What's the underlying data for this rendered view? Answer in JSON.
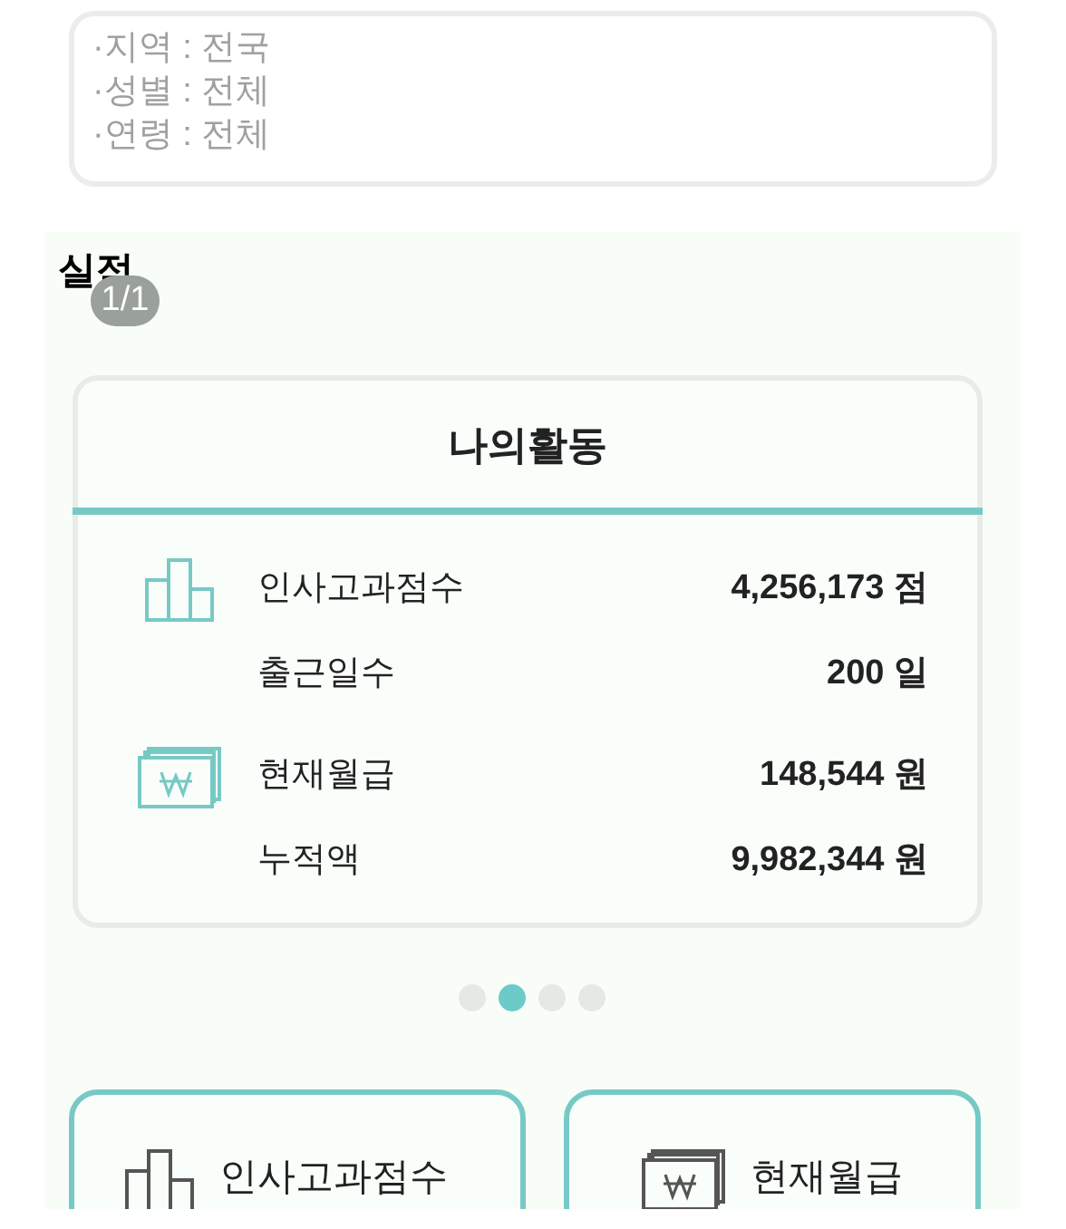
{
  "filters": [
    "·지역 : 전국",
    "·성별 : 전체",
    "·연령 : 전체"
  ],
  "section": {
    "title": "실적",
    "badge": "1/1"
  },
  "card": {
    "title": "나의활동",
    "rows": [
      {
        "kind": "chart",
        "label": "인사고과점수",
        "value": "4,256,173 점"
      },
      {
        "kind": "plain",
        "label": "출근일수",
        "value": "200 일"
      },
      {
        "kind": "money",
        "label": "현재월급",
        "value": "148,544 원"
      },
      {
        "kind": "plain",
        "label": "누적액",
        "value": "9,982,344 원"
      }
    ]
  },
  "pager": [
    {
      "selected": false
    },
    {
      "selected": true
    },
    {
      "selected": false
    },
    {
      "selected": false
    }
  ],
  "tiles": [
    {
      "kind": "chart",
      "label": "인사고과점수"
    },
    {
      "kind": "money",
      "label": "현재월급"
    }
  ]
}
